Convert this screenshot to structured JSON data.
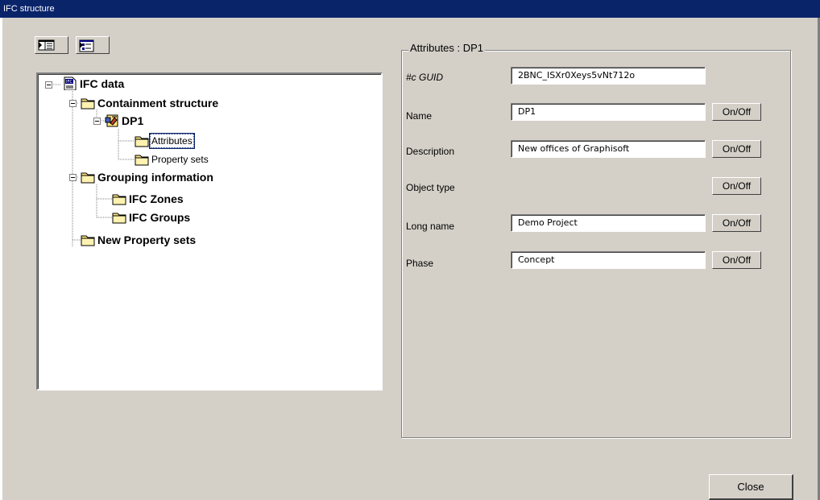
{
  "window": {
    "title": "IFC structure"
  },
  "toolbar": [
    {
      "icon": "view-panes-icon"
    },
    {
      "icon": "view-details-icon"
    }
  ],
  "tree": {
    "nodes": [
      {
        "label": "IFC data",
        "icon": "ifc-file-icon",
        "expanded": true
      },
      {
        "label": "Containment structure",
        "icon": "folder-icon",
        "expanded": true
      },
      {
        "label": "DP1",
        "icon": "project-icon",
        "expanded": true
      },
      {
        "label": "Attributes",
        "icon": "folder-icon",
        "selected": true
      },
      {
        "label": "Property sets",
        "icon": "folder-icon"
      },
      {
        "label": "Grouping information",
        "icon": "folder-icon",
        "expanded": true
      },
      {
        "label": "IFC Zones",
        "icon": "folder-icon"
      },
      {
        "label": "IFC Groups",
        "icon": "folder-icon"
      },
      {
        "label": "New Property sets",
        "icon": "folder-icon"
      }
    ]
  },
  "attributes": {
    "group_title": "Attributes : DP1",
    "fields": [
      {
        "label": "#c GUID",
        "value": "2BNC_ISXr0Xeys5vNt712o",
        "toggle": ""
      },
      {
        "label": "Name",
        "value": "DP1",
        "toggle": "On/Off"
      },
      {
        "label": "Description",
        "value": "New offices of Graphisoft",
        "toggle": "On/Off"
      },
      {
        "label": "Object type",
        "value": "",
        "toggle": "On/Off"
      },
      {
        "label": "Long name",
        "value": "Demo Project",
        "toggle": "On/Off"
      },
      {
        "label": "Phase",
        "value": "Concept",
        "toggle": "On/Off"
      }
    ]
  },
  "footer": {
    "close_label": "Close"
  }
}
